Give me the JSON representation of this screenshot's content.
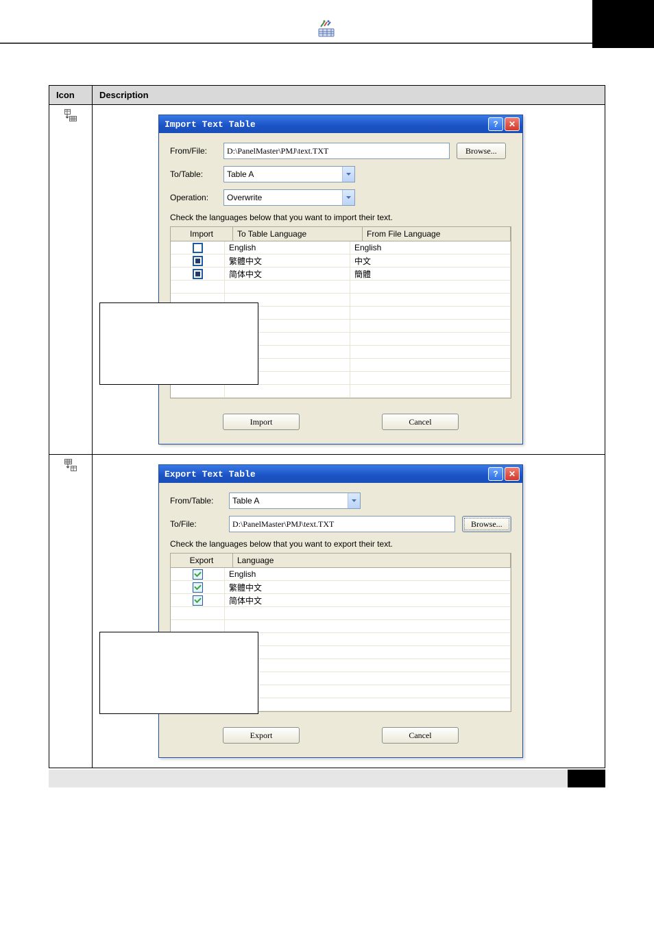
{
  "table": {
    "header_icon": "Icon",
    "header_desc": "Description"
  },
  "import": {
    "title": "Import Text Table",
    "from_file_lbl": "From/File:",
    "from_file_val": "D:\\PanelMaster\\PMJ\\text.TXT",
    "browse": "Browse...",
    "to_table_lbl": "To/Table:",
    "to_table_val": "Table A",
    "operation_lbl": "Operation:",
    "operation_val": "Overwrite",
    "instr": "Check the languages below that you want to import their text.",
    "col1": "Import",
    "col2": "To Table Language",
    "col3": "From File Language",
    "rows": [
      {
        "chk": false,
        "to": "English",
        "from": "English"
      },
      {
        "chk": true,
        "to": "繁體中文",
        "from": "中文"
      },
      {
        "chk": true,
        "to": "简体中文",
        "from": "簡體"
      }
    ],
    "import_btn": "Import",
    "cancel_btn": "Cancel"
  },
  "export": {
    "title": "Export Text Table",
    "from_table_lbl": "From/Table:",
    "from_table_val": "Table A",
    "to_file_lbl": "To/File:",
    "to_file_val": "D:\\PanelMaster\\PMJ\\text.TXT",
    "browse": "Browse...",
    "instr": "Check the languages below that you want to export their text.",
    "col1": "Export",
    "col2": "Language",
    "rows": [
      {
        "chk": true,
        "lang": "English"
      },
      {
        "chk": true,
        "lang": "繁體中文"
      },
      {
        "chk": true,
        "lang": "简体中文"
      }
    ],
    "export_btn": "Export",
    "cancel_btn": "Cancel"
  }
}
